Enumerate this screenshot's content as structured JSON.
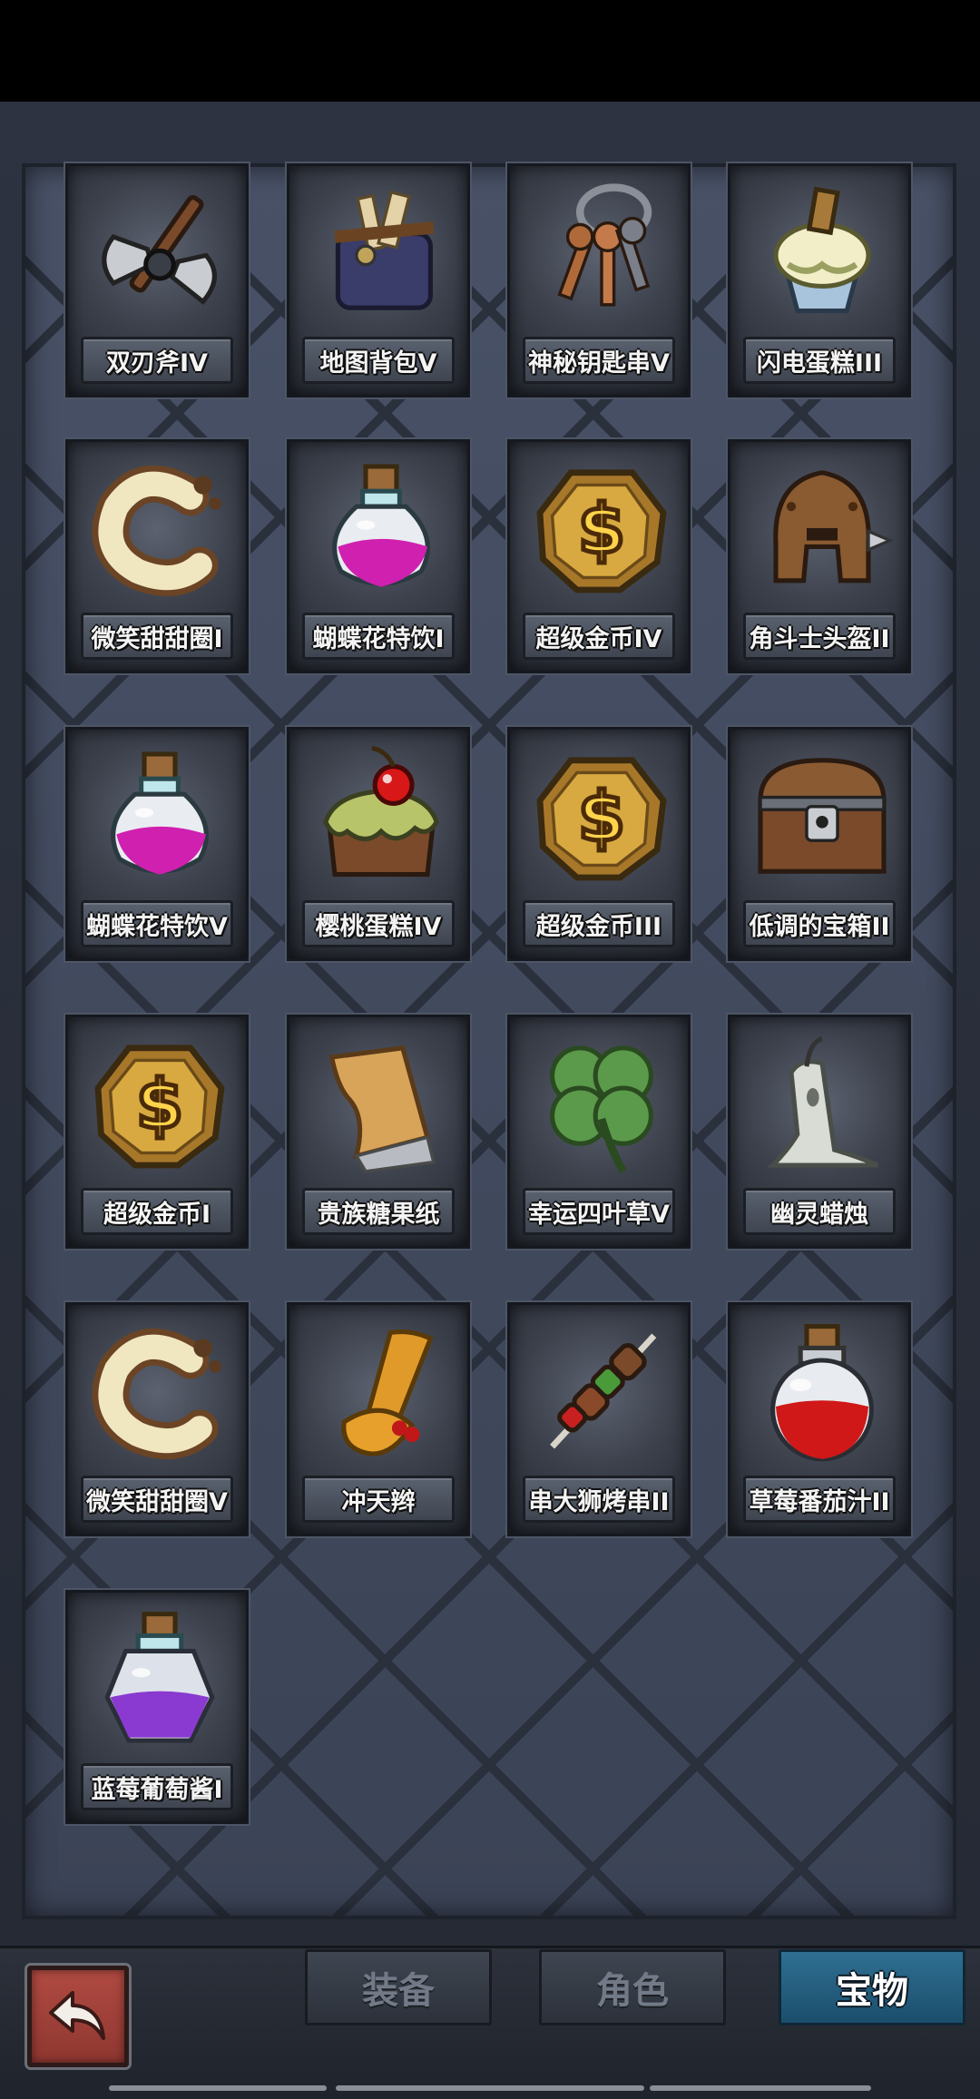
{
  "tabs": [
    {
      "label": "装备",
      "active": false
    },
    {
      "label": "角色",
      "active": false
    },
    {
      "label": "宝物",
      "active": true
    }
  ],
  "items": [
    {
      "name": "双刃斧IV",
      "icon": "double-axe-icon"
    },
    {
      "name": "地图背包V",
      "icon": "map-bag-icon"
    },
    {
      "name": "神秘钥匙串V",
      "icon": "key-ring-icon"
    },
    {
      "name": "闪电蛋糕III",
      "icon": "lightning-cake-icon"
    },
    {
      "name": "微笑甜甜圈I",
      "icon": "donut-icon"
    },
    {
      "name": "蝴蝶花特饮I",
      "icon": "pink-potion-icon"
    },
    {
      "name": "超级金币IV",
      "icon": "gold-coin-icon"
    },
    {
      "name": "角斗士头盔II",
      "icon": "gladiator-helmet-icon"
    },
    {
      "name": "蝴蝶花特饮V",
      "icon": "pink-potion-icon"
    },
    {
      "name": "樱桃蛋糕IV",
      "icon": "cherry-cake-icon"
    },
    {
      "name": "超级金币III",
      "icon": "gold-coin-icon"
    },
    {
      "name": "低调的宝箱II",
      "icon": "treasure-chest-icon"
    },
    {
      "name": "超级金币I",
      "icon": "gold-coin-icon"
    },
    {
      "name": "贵族糖果纸",
      "icon": "candy-wrapper-icon"
    },
    {
      "name": "幸运四叶草V",
      "icon": "four-leaf-clover-icon"
    },
    {
      "name": "幽灵蜡烛",
      "icon": "ghost-candle-icon"
    },
    {
      "name": "微笑甜甜圈V",
      "icon": "donut-icon"
    },
    {
      "name": "冲天辫",
      "icon": "pigtail-icon"
    },
    {
      "name": "串大狮烤串II",
      "icon": "kebab-icon"
    },
    {
      "name": "草莓番茄汁II",
      "icon": "red-potion-icon"
    },
    {
      "name": "蓝莓葡萄酱I",
      "icon": "purple-potion-icon"
    }
  ],
  "icons": {
    "back": "back-arrow-icon"
  },
  "colors": {
    "active_tab": "#2f6f92",
    "back_button": "#b04a42"
  }
}
